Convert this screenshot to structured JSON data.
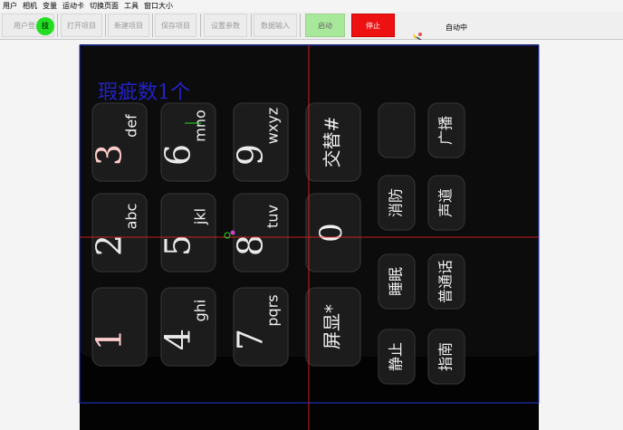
{
  "menu": [
    "用户",
    "相机",
    "变量",
    "运动卡",
    "切换页面",
    "工具",
    "窗口大小"
  ],
  "toolbar": {
    "login": "用户登录",
    "ball": "技",
    "open_project": "打开项目",
    "new_project": "新建项目",
    "save_project": "保存项目",
    "settings": "设置参数",
    "data_input": "数据输入",
    "start": "启动",
    "stop": "停止",
    "status": "自动中"
  },
  "result": {
    "defect_text": "瑕疵数1个"
  },
  "keypad": {
    "col1": [
      {
        "num": "3",
        "letters": "def"
      },
      {
        "num": "2",
        "letters": "abc"
      },
      {
        "num": "1",
        "letters": ""
      }
    ],
    "col2": [
      {
        "num": "6",
        "letters": "mno"
      },
      {
        "num": "5",
        "letters": "jkl"
      },
      {
        "num": "4",
        "letters": "ghi"
      }
    ],
    "col3": [
      {
        "num": "9",
        "letters": "wxyz"
      },
      {
        "num": "8",
        "letters": "tuv"
      },
      {
        "num": "7",
        "letters": "pqrs"
      }
    ],
    "col4": [
      "交替#",
      "0",
      "屏显*"
    ],
    "col5": [
      "",
      "消防",
      "睡眠",
      "静止"
    ],
    "col6": [
      "广播",
      "声道",
      "普通话",
      "指南"
    ]
  },
  "colors": {
    "stop": "#ee1111",
    "start": "#a8e89a",
    "crosshair": "#ff2222",
    "roi": "#2233cc",
    "defect_text": "#2222cc"
  }
}
